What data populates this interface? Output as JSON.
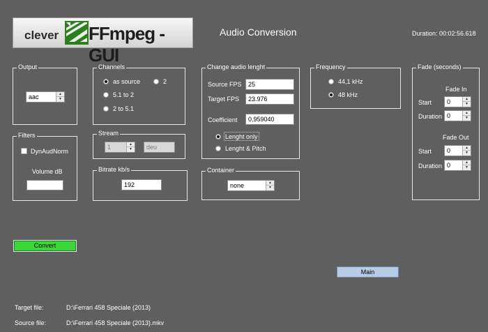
{
  "header": {
    "logo_text_prefix": "clever",
    "logo_text_main": "FFmpeg - GUI",
    "title": "Audio Conversion",
    "duration": "Duration: 00:02:56.618"
  },
  "output": {
    "label": "Output",
    "value": "aac"
  },
  "filters": {
    "label": "Filters",
    "dynaudnorm_label": "DynAudNorm",
    "volume_label": "Volume dB",
    "volume_value": ""
  },
  "channels": {
    "label": "Channels",
    "as_source": "as source",
    "two": "2",
    "five_to_two": "5.1 to 2",
    "two_to_five": "2 to 5.1"
  },
  "stream": {
    "label": "Stream",
    "number": "1",
    "language": "deu"
  },
  "bitrate": {
    "label": "Bitrate kb/s",
    "value": "192"
  },
  "length": {
    "label": "Change audio lenght",
    "source_fps_label": "Source FPS",
    "source_fps": "25",
    "target_fps_label": "Target FPS",
    "target_fps": "23.976",
    "coefficient_label": "Coefficient",
    "coefficient": "0,959040",
    "length_only": "Lenght only",
    "length_pitch": "Lenght & Pitch"
  },
  "container": {
    "label": "Container",
    "value": "none"
  },
  "frequency": {
    "label": "Frequency",
    "f44": "44,1 kHz",
    "f48": "48 kHz"
  },
  "fade": {
    "label": "Fade (seconds)",
    "fade_in": "Fade In",
    "fade_out": "Fade Out",
    "start": "Start",
    "duration": "Duration",
    "in_start": "0",
    "in_duration": "0",
    "out_start": "0",
    "out_duration": "0"
  },
  "buttons": {
    "convert": "Convert",
    "main": "Main"
  },
  "files": {
    "target_label": "Target file:",
    "target_value": "D:\\Ferrari 458 Speciale (2013)",
    "source_label": "Source file:",
    "source_value": "D:\\Ferrari 458 Speciale (2013).mkv"
  },
  "colors": {
    "background": "#5f5f5f",
    "convert": "#3ad63a",
    "main": "#b8cbe4"
  }
}
